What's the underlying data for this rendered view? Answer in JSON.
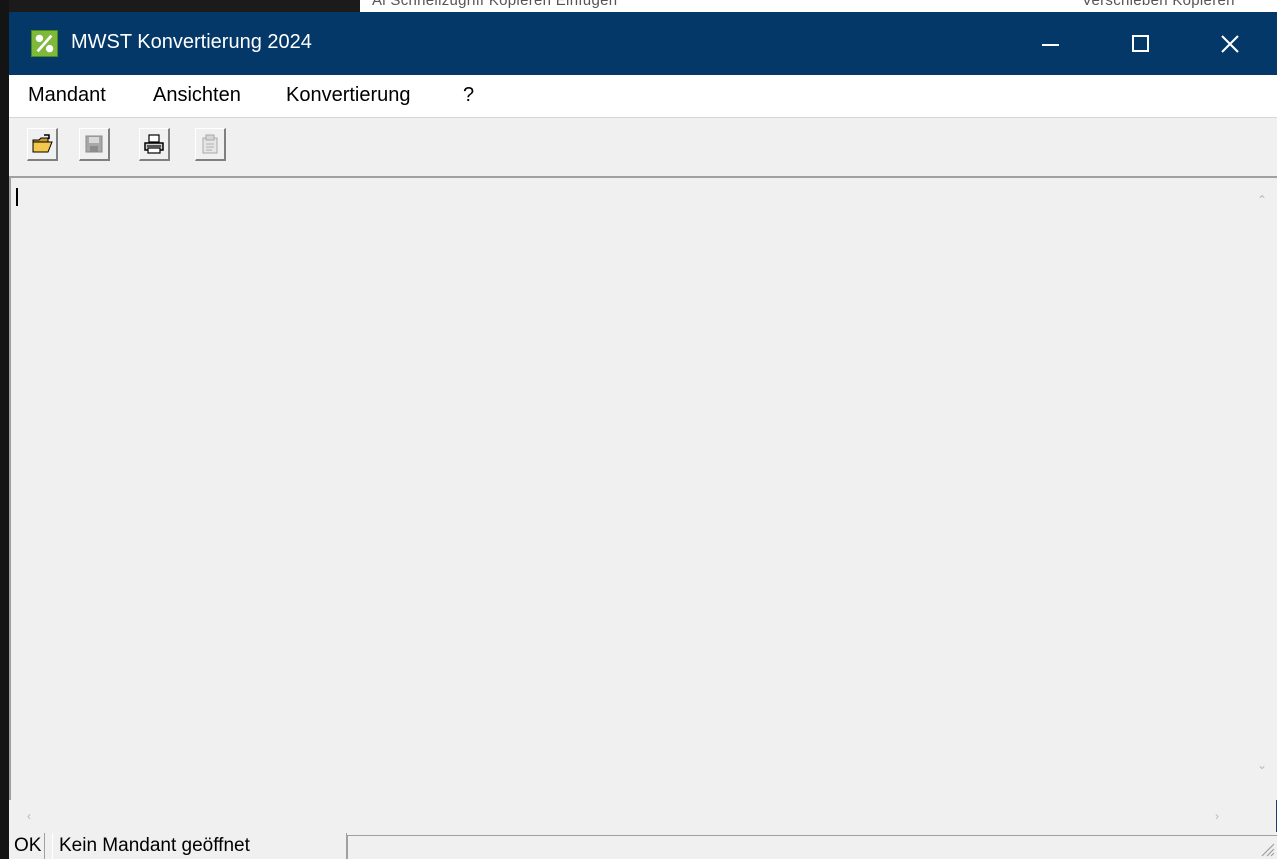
{
  "background": {
    "left_text": "Ai Schnellzugriff  Kopieren  Einfügen",
    "right_text": "Verschieben  Kopieren"
  },
  "window": {
    "title": "MWST Konvertierung 2024",
    "app_icon": "percent-icon",
    "title_color": "#033869",
    "controls": [
      "minimize",
      "maximize",
      "close"
    ]
  },
  "menu": {
    "items": [
      {
        "label": "Mandant"
      },
      {
        "label": "Ansichten"
      },
      {
        "label": "Konvertierung"
      },
      {
        "label": "?"
      }
    ]
  },
  "toolbar": {
    "buttons": [
      {
        "icon": "open-folder-icon",
        "enabled": true
      },
      {
        "icon": "save-disk-icon",
        "enabled": false
      },
      {
        "icon": "printer-icon",
        "enabled": true
      },
      {
        "icon": "properties-icon",
        "enabled": false
      }
    ]
  },
  "status": {
    "ok": "OK",
    "message": "Kein Mandant geöffnet"
  }
}
